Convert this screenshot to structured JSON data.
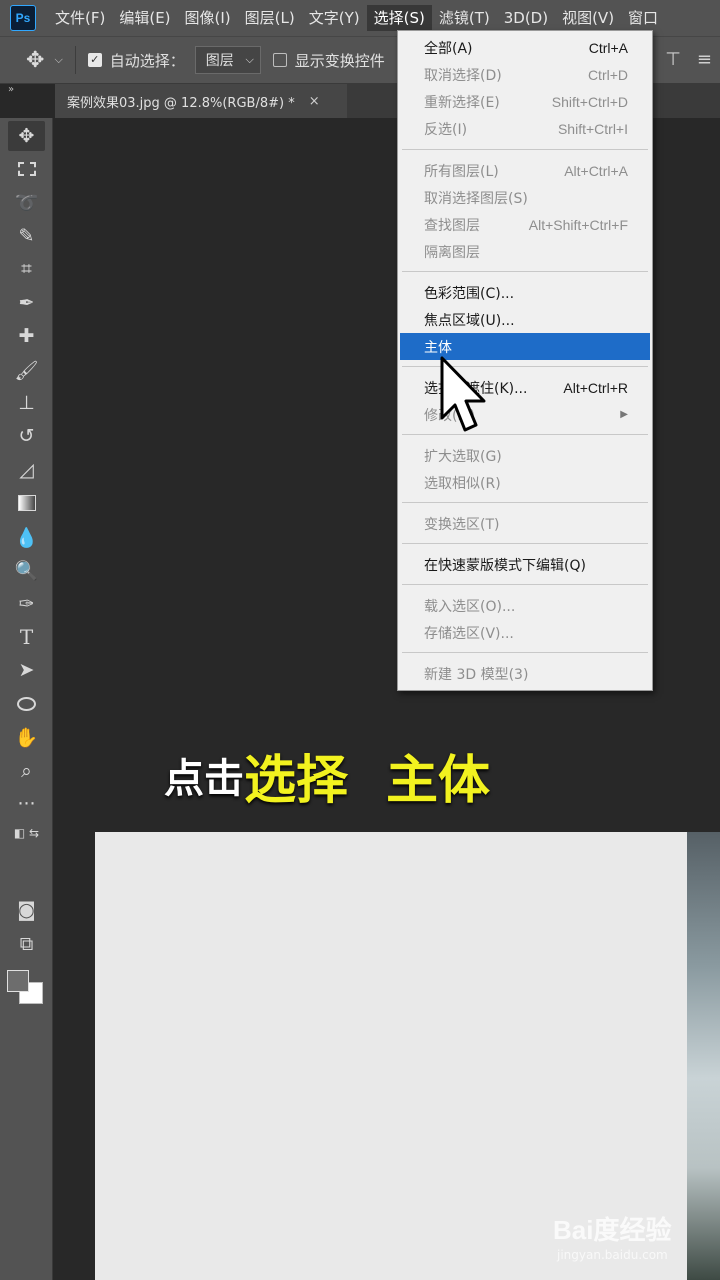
{
  "app": {
    "logo": "Ps"
  },
  "menubar": {
    "items": [
      "文件(F)",
      "编辑(E)",
      "图像(I)",
      "图层(L)",
      "文字(Y)",
      "选择(S)",
      "滤镜(T)",
      "3D(D)",
      "视图(V)",
      "窗口"
    ],
    "active_index": 5
  },
  "options": {
    "auto_select_label": "自动选择：",
    "auto_select_checked": true,
    "layer_dropdown_value": "图层",
    "transform_label": "显示变换控件"
  },
  "tab": {
    "title": "案例效果03.jpg @ 12.8%(RGB/8#) *",
    "close": "×"
  },
  "select_menu": {
    "items": [
      {
        "label": "全部(A)",
        "shortcut": "Ctrl+A",
        "enabled": true
      },
      {
        "label": "取消选择(D)",
        "shortcut": "Ctrl+D",
        "enabled": false
      },
      {
        "label": "重新选择(E)",
        "shortcut": "Shift+Ctrl+D",
        "enabled": false
      },
      {
        "label": "反选(I)",
        "shortcut": "Shift+Ctrl+I",
        "enabled": false
      },
      {
        "label": "所有图层(L)",
        "shortcut": "Alt+Ctrl+A",
        "enabled": false
      },
      {
        "label": "取消选择图层(S)",
        "shortcut": "",
        "enabled": false
      },
      {
        "label": "查找图层",
        "shortcut": "Alt+Shift+Ctrl+F",
        "enabled": false
      },
      {
        "label": "隔离图层",
        "shortcut": "",
        "enabled": false
      },
      {
        "label": "色彩范围(C)...",
        "shortcut": "",
        "enabled": true
      },
      {
        "label": "焦点区域(U)...",
        "shortcut": "",
        "enabled": true
      },
      {
        "label": "主体",
        "shortcut": "",
        "enabled": true,
        "highlighted": true
      },
      {
        "label": "选择并遮住(K)...",
        "shortcut": "Alt+Ctrl+R",
        "enabled": true
      },
      {
        "label": "修改(M)",
        "shortcut": "",
        "enabled": false,
        "submenu": true
      },
      {
        "label": "扩大选取(G)",
        "shortcut": "",
        "enabled": false
      },
      {
        "label": "选取相似(R)",
        "shortcut": "",
        "enabled": false
      },
      {
        "label": "变换选区(T)",
        "shortcut": "",
        "enabled": false
      },
      {
        "label": "在快速蒙版模式下编辑(Q)",
        "shortcut": "",
        "enabled": true
      },
      {
        "label": "载入选区(O)...",
        "shortcut": "",
        "enabled": false
      },
      {
        "label": "存储选区(V)...",
        "shortcut": "",
        "enabled": false
      },
      {
        "label": "新建 3D 模型(3)",
        "shortcut": "",
        "enabled": false
      }
    ]
  },
  "caption": {
    "white": "点击",
    "yellow1": "选择",
    "yellow2": "主体"
  },
  "watermark": {
    "text": "Bai度经验",
    "url": "jingyan.baidu.com"
  },
  "colors": {
    "highlight": "#1e6cc8",
    "caption_yellow": "#f2f21f",
    "panel": "#535353",
    "canvas_bg": "#282828"
  }
}
